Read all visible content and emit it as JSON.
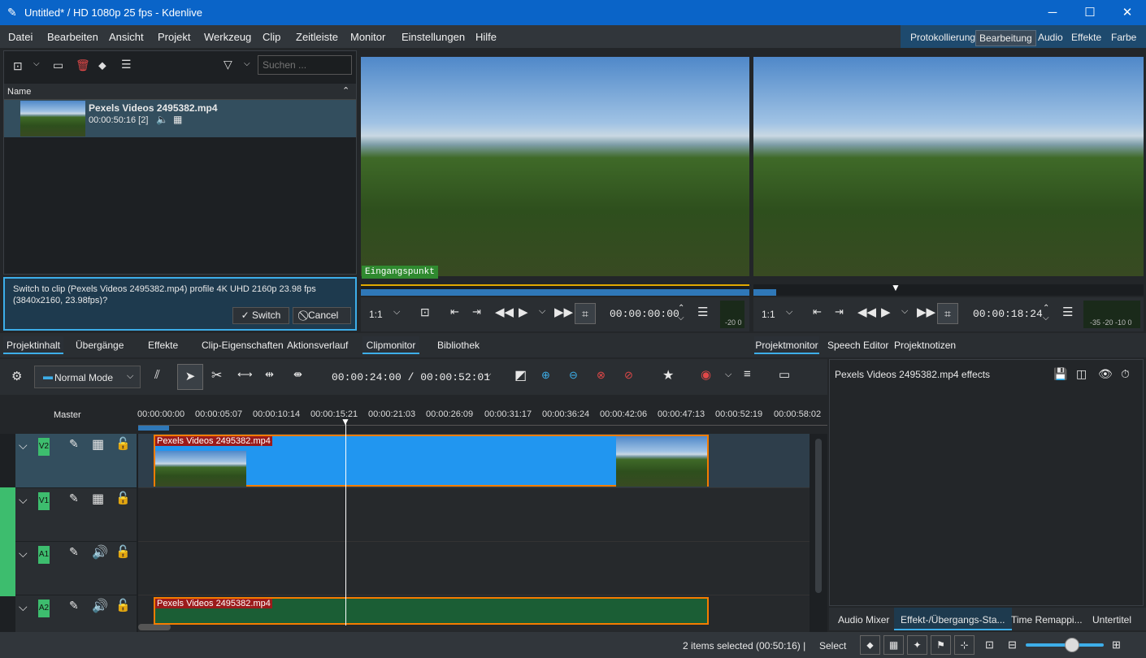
{
  "window": {
    "title": "Untitled* / HD 1080p 25 fps - Kdenlive",
    "minimize": "─",
    "maximize": "☐",
    "close": "✕"
  },
  "menu": [
    "Datei",
    "Bearbeiten",
    "Ansicht",
    "Projekt",
    "Werkzeug",
    "Clip",
    "Zeitleiste",
    "Monitor",
    "Einstellungen",
    "Hilfe"
  ],
  "workspaces": [
    "Protokollierung",
    "Bearbeitung",
    "Audio",
    "Effekte",
    "Farbe"
  ],
  "bin": {
    "search_placeholder": "Suchen ...",
    "column": "Name",
    "clip_name": "Pexels Videos 2495382.mp4",
    "clip_meta": "00:00:50:16 [2]"
  },
  "notice": {
    "text": "Switch to clip (Pexels Videos 2495382.mp4) profile 4K UHD 2160p 23.98 fps (3840x2160, 23.98fps)?",
    "switch": "Switch",
    "cancel": "Cancel"
  },
  "clipmonitor": {
    "marker": "Eingangspunkt",
    "zoom": "1:1",
    "timecode": "00:00:00:00",
    "meter": "-20 0"
  },
  "projmonitor": {
    "zoom": "1:1",
    "timecode": "00:00:18:24",
    "meter": "-35 -20 -10 0"
  },
  "left_tabs": [
    "Projektinhalt",
    "Übergänge",
    "Effekte",
    "Clip-Eigenschaften",
    "Aktionsverlauf"
  ],
  "mid_tabs": [
    "Clipmonitor",
    "Bibliothek"
  ],
  "right_tabs": [
    "Projektmonitor",
    "Speech Editor",
    "Projektnotizen"
  ],
  "timeline": {
    "mode": "Normal Mode",
    "position": "00:00:24:00 / 00:00:52:01",
    "master": "Master",
    "ruler": [
      "00:00:00:00",
      "00:00:05:07",
      "00:00:10:14",
      "00:00:15:21",
      "00:00:21:03",
      "00:00:26:09",
      "00:00:31:17",
      "00:00:36:24",
      "00:00:42:06",
      "00:00:47:13",
      "00:00:52:19",
      "00:00:58:02"
    ],
    "tracks": [
      "V2",
      "V1",
      "A1",
      "A2"
    ],
    "clip_label": "Pexels Videos 2495382.mp4"
  },
  "effects": {
    "title": "Pexels Videos 2495382.mp4 effects"
  },
  "bottom_tabs": [
    "Audio Mixer",
    "Effekt-/Übergangs-Sta...",
    "Time Remappi...",
    "Untertitel"
  ],
  "status": {
    "selection": "2 items selected (00:50:16) |",
    "tool": "Select"
  },
  "colors": {
    "accent": "#3daee9",
    "track": "#3dbd6e",
    "clip_border": "#f57c00",
    "clip_video": "#2196f0"
  }
}
